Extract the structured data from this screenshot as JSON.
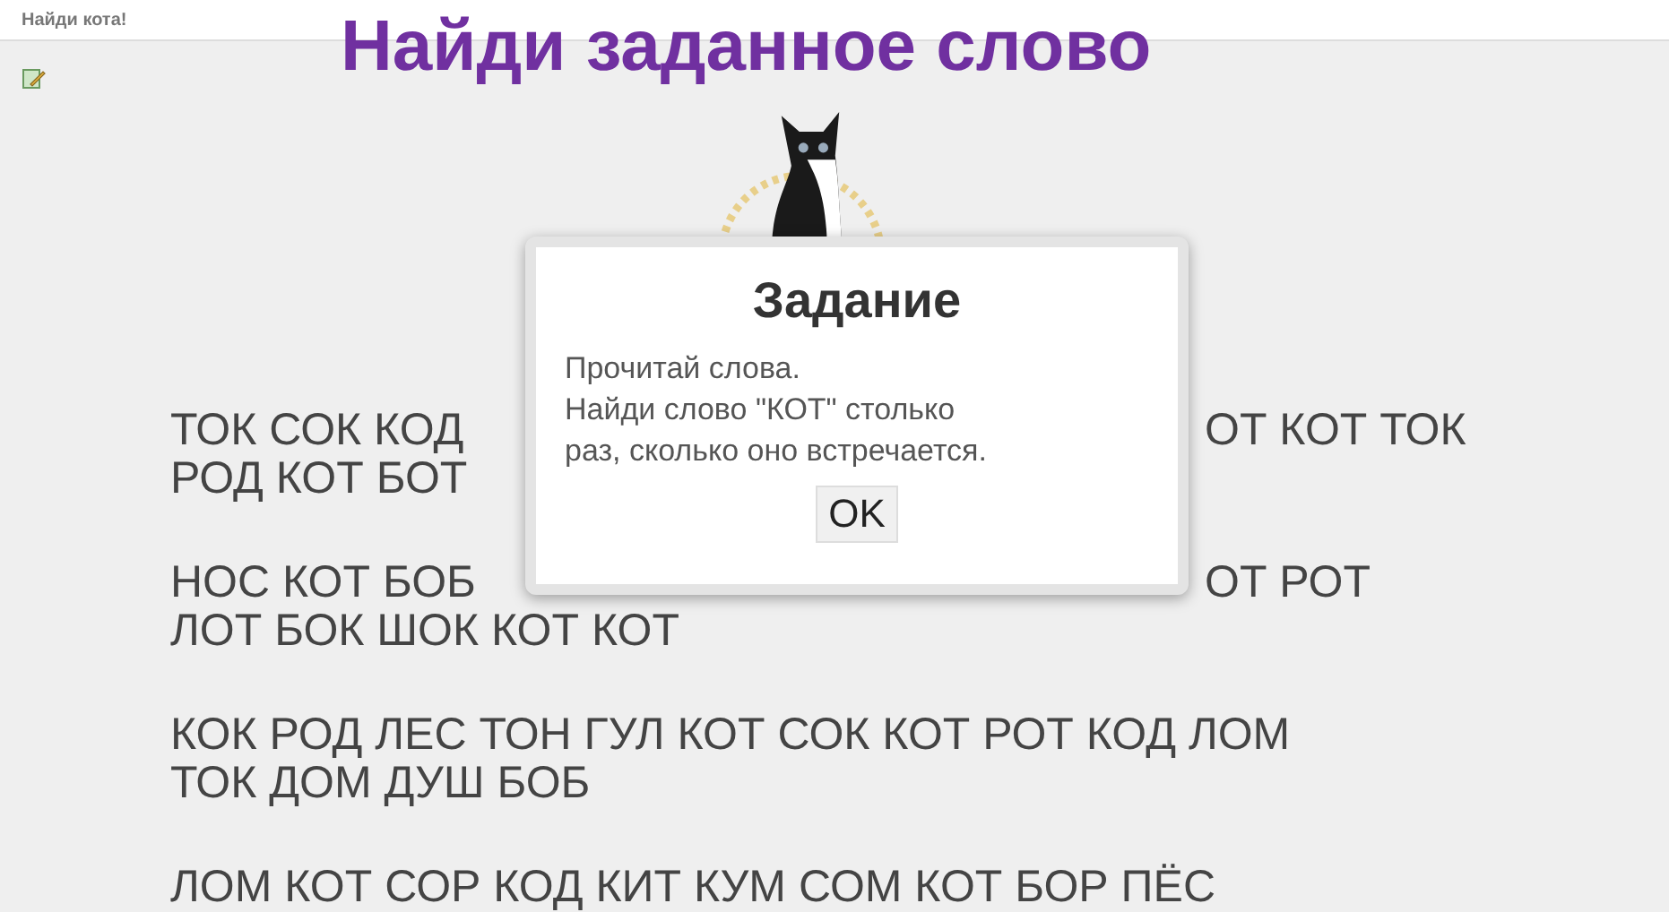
{
  "header": {
    "title": "Найди кота!"
  },
  "caption": "Найди заданное слово",
  "paragraphs": [
    {
      "lines": [
        {
          "left": "ТОК СОК КОД",
          "right": "ОТ КОТ ТОК"
        },
        {
          "left": "РОД КОТ БОТ"
        }
      ]
    },
    {
      "lines": [
        {
          "left": "НОС КОТ БОБ",
          "right": "ОТ РОТ"
        },
        {
          "left": "ЛОТ БОК ШОК КОТ КОТ"
        }
      ]
    },
    {
      "lines": [
        {
          "left": "КОК РОД ЛЕС ТОН ГУЛ КОТ СОК КОТ РОТ КОД ЛОМ"
        },
        {
          "left": "ТОК ДОМ ДУШ БОБ"
        }
      ]
    },
    {
      "lines": [
        {
          "left": "ЛОМ КОТ СОР КОД КИТ КУМ СОМ КОТ БОР ПЁС"
        }
      ]
    }
  ],
  "dialog": {
    "title": "Задание",
    "lines": [
      "Прочитай слова.",
      "Найди слово \"КОТ\" столько",
      "раз, сколько оно встречается."
    ],
    "button": "OK"
  }
}
